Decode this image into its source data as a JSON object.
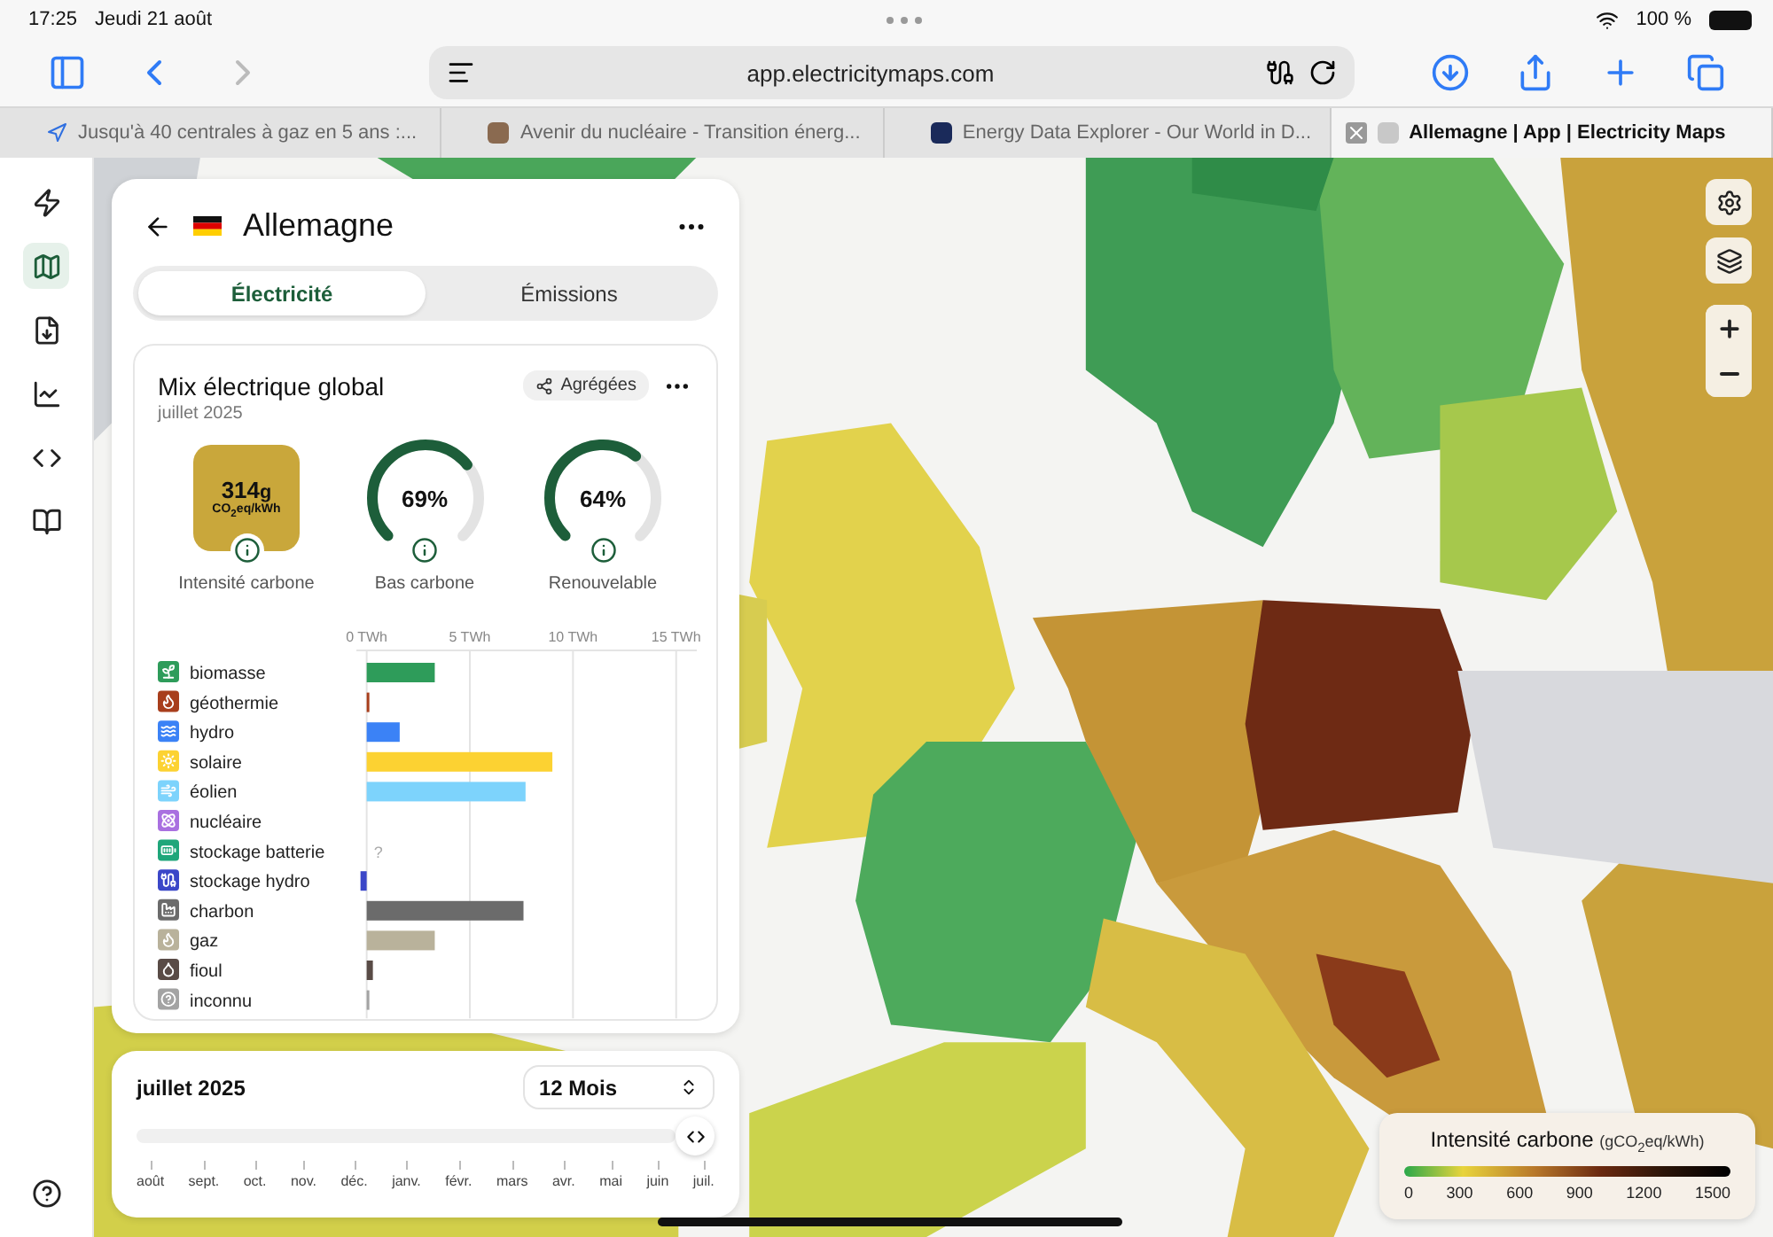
{
  "status_bar": {
    "time": "17:25",
    "date": "Jeudi 21 août",
    "battery": "100 %"
  },
  "toolbar": {
    "url": "app.electricitymaps.com"
  },
  "tabs": [
    {
      "title": "Jusqu'à 40 centrales à gaz en 5 ans :...",
      "selected": false
    },
    {
      "title": "Avenir du nucléaire - Transition énerg...",
      "selected": false
    },
    {
      "title": "Energy Data Explorer - Our World in D...",
      "selected": false
    },
    {
      "title": "Allemagne | App | Electricity Maps",
      "selected": true
    }
  ],
  "rail": [
    {
      "kind": "logo",
      "selected": false
    },
    {
      "kind": "map",
      "selected": true
    },
    {
      "kind": "download",
      "selected": false
    },
    {
      "kind": "chart",
      "selected": false
    },
    {
      "kind": "code",
      "selected": false
    },
    {
      "kind": "book",
      "selected": false
    }
  ],
  "zone": {
    "name": "Allemagne"
  },
  "view_tabs": [
    {
      "label": "Électricité",
      "selected": true
    },
    {
      "label": "Émissions",
      "selected": false
    }
  ],
  "mix": {
    "title": "Mix électrique global",
    "date": "juillet 2025",
    "mode_button": "Agrégées",
    "carbon": {
      "value": "314",
      "unit": "g",
      "sub": "CO$_{2}$eq/kWh",
      "label": "Intensité carbone"
    },
    "gauges": [
      {
        "value": "69%",
        "label": "Bas carbone",
        "level": 0.69
      },
      {
        "value": "64%",
        "label": "Renouvelable",
        "level": 0.64
      }
    ],
    "sources": [
      {
        "kind": "biomass",
        "color": "#2e9c5a"
      },
      {
        "kind": "geothermal",
        "color": "#a83e1c"
      },
      {
        "kind": "hydro",
        "color": "#3b82f6"
      },
      {
        "kind": "solar",
        "color": "#fcd232"
      },
      {
        "kind": "wind",
        "color": "#7dd3fc"
      },
      {
        "kind": "nuclear",
        "color": "#a970e0"
      },
      {
        "kind": "battery",
        "color": "#1fa67a"
      },
      {
        "kind": "pumped",
        "color": "#3b47c8"
      },
      {
        "kind": "coal",
        "color": "#6b6b6b"
      },
      {
        "kind": "gas",
        "color": "#b9b29b"
      },
      {
        "kind": "oil",
        "color": "#594b46"
      },
      {
        "kind": "unknown",
        "color": "#a3a3a3"
      }
    ],
    "chart_data": {
      "type": "bar",
      "orientation": "horizontal",
      "categories": [
        "biomasse",
        "géothermie",
        "hydro",
        "solaire",
        "éolien",
        "nucléaire",
        "stockage batterie",
        "stockage hydro",
        "charbon",
        "gaz",
        "fioul",
        "inconnu"
      ],
      "values": [
        3.3,
        0.1,
        1.6,
        9.0,
        7.7,
        0,
        null,
        -0.3,
        7.6,
        3.3,
        0.3,
        0.1
      ],
      "xlim": [
        -0.5,
        16
      ],
      "grid": true,
      "xticks": [
        {
          "value": 0,
          "label": "0 TWh"
        },
        {
          "value": 5,
          "label": "5 TWh"
        },
        {
          "value": 10,
          "label": "10 TWh"
        },
        {
          "value": 15,
          "label": "15 TWh"
        }
      ],
      "annotations": [
        "?"
      ]
    }
  },
  "timeline": {
    "date": "juillet 2025",
    "range": "12 Mois",
    "level": 1,
    "months": [
      "août",
      "sept.",
      "oct.",
      "nov.",
      "déc.",
      "janv.",
      "févr.",
      "mars",
      "avr.",
      "mai",
      "juin",
      "juil."
    ]
  },
  "legend": {
    "title": "Intensité carbone",
    "unit": "(gCO$_{2}$eq/kWh)",
    "ticks": [
      "0",
      "300",
      "600",
      "900",
      "1200",
      "1500"
    ]
  }
}
